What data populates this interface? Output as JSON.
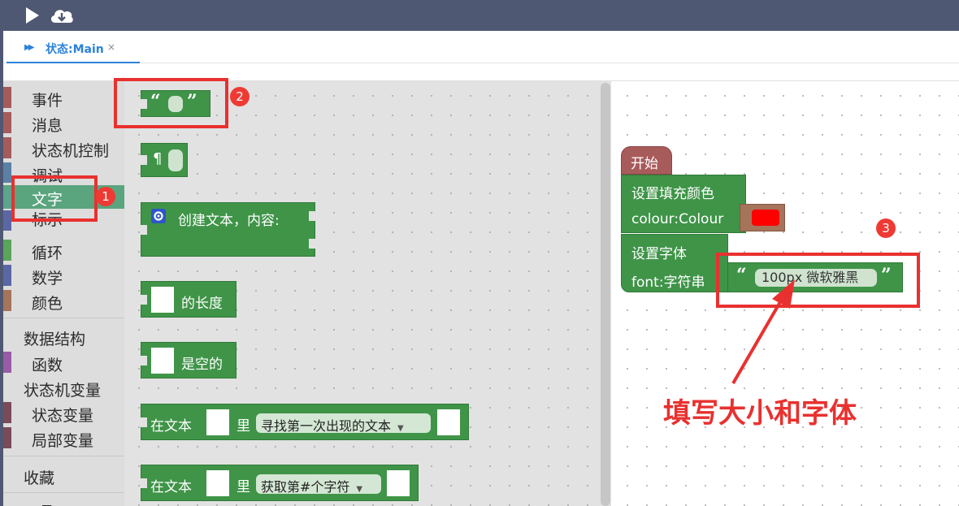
{
  "toolbar": {
    "run_icon": "play-icon",
    "download_icon": "cloud-download-icon"
  },
  "tab": {
    "label": "状态:Main",
    "close": "×"
  },
  "sidebar": {
    "categories": [
      {
        "label": "事件",
        "color": "#a55b5b"
      },
      {
        "label": "消息",
        "color": "#a55b5b"
      },
      {
        "label": "状态机控制",
        "color": "#a55b5b"
      },
      {
        "label": "调试",
        "color": "#5b80a5"
      },
      {
        "label": "文字",
        "color": "#5ba58c"
      },
      {
        "label": "标示",
        "color": "#5b67a5"
      },
      {
        "label": "循环",
        "color": "#5ba55b"
      },
      {
        "label": "数学",
        "color": "#5b67a5"
      },
      {
        "label": "颜色",
        "color": "#a5745b"
      }
    ],
    "data_structures": "数据结构",
    "functions": {
      "label": "函数",
      "color": "#995ba5"
    },
    "fsm_variables": "状态机变量",
    "state_variables": {
      "label": "状态变量",
      "color": "#7a4a5a"
    },
    "local_variables": {
      "label": "局部变量",
      "color": "#7a4a5a"
    },
    "favorites": "收藏",
    "last_partial": "工具"
  },
  "flyout": {
    "quote_open": "“",
    "quote_close": "”",
    "pilcrow": "¶",
    "create_text": "创建文本，内容:",
    "length_of": "的长度",
    "is_empty": "是空的",
    "in_text": "在文本",
    "in": "里",
    "find_first": "寻找第一次出现的文本",
    "get_char": "获取第#个字符"
  },
  "workspace": {
    "start": "开始",
    "set_fill": "设置填充颜色",
    "colour_label": "colour:Colour",
    "fill_color": "#ff0000",
    "set_font": "设置字体",
    "font_label": "font:字符串",
    "font_value": "100px  微软雅黑"
  },
  "annotations": {
    "badge1": "1",
    "badge2": "2",
    "badge3": "3",
    "note": "填写大小和字体",
    "color": "#e8312f"
  }
}
